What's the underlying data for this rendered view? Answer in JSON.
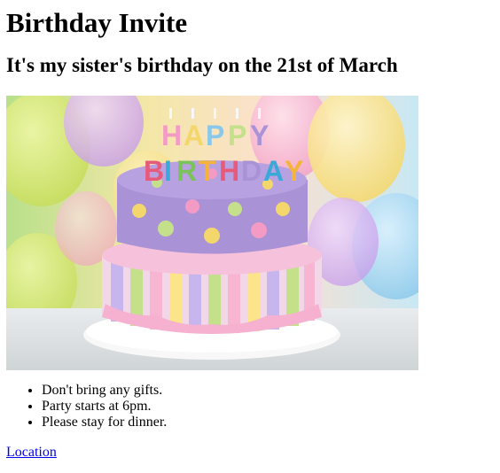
{
  "page": {
    "title": "Birthday Invite",
    "subtitle": "It's my sister's birthday on the 21st of March"
  },
  "hero_image": {
    "description": "birthday cake with HAPPY BIRTHDAY candles",
    "candle_letters": [
      "HAPPY",
      "BIRTHDAY"
    ]
  },
  "details": {
    "items": [
      "Don't bring any gifts.",
      "Party starts at 6pm.",
      "Please stay for dinner."
    ]
  },
  "location_link": {
    "label": "Location"
  },
  "colors": {
    "link": "#0000ee",
    "text": "#000000"
  }
}
